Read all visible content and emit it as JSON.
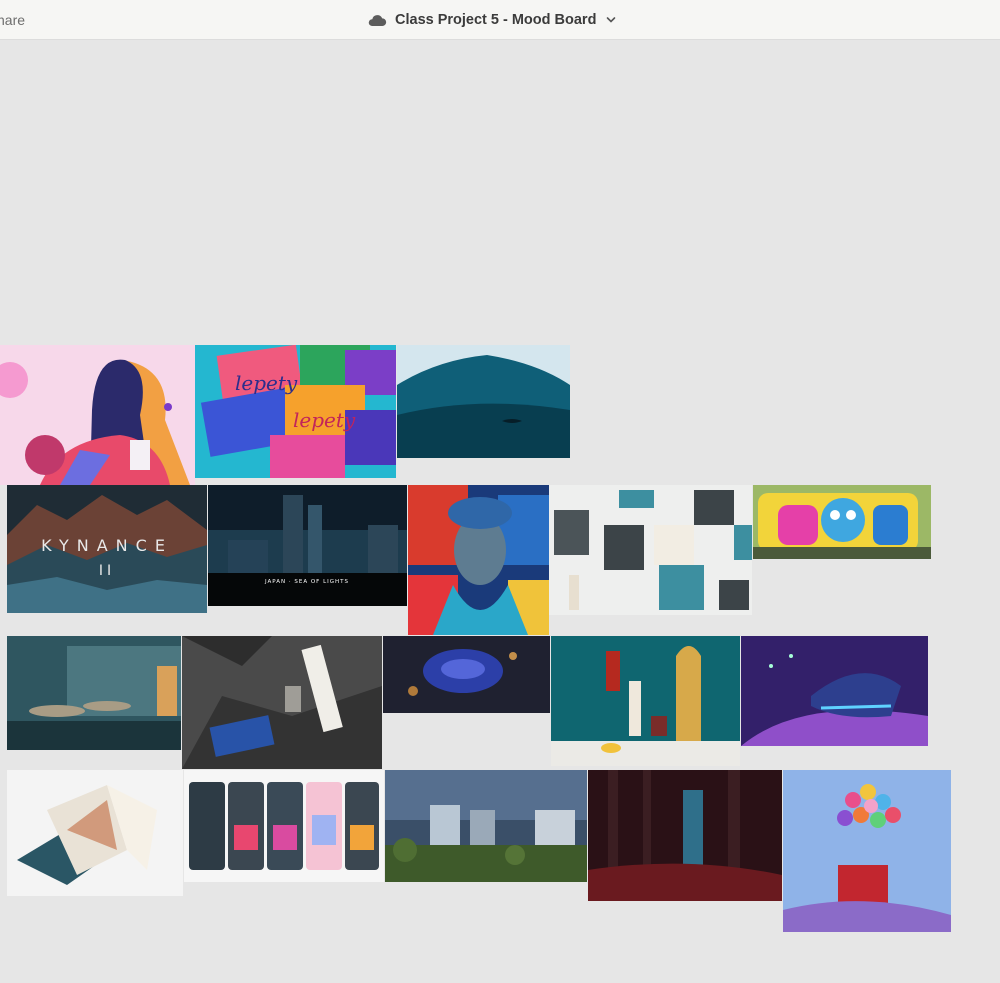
{
  "toolbar": {
    "share_label": "Share",
    "share_visible": "hare",
    "document_title": "Class Project 5 - Mood Board",
    "cloud_icon": "cloud-icon",
    "dropdown_icon": "chevron-down-icon"
  },
  "board": {
    "background": "#e6e6e6",
    "image_overlays": {
      "kynance_title": "KYNANCE",
      "kynance_numeral": "II",
      "japan_caption": "JAPAN · SEA OF LIGHTS"
    }
  }
}
